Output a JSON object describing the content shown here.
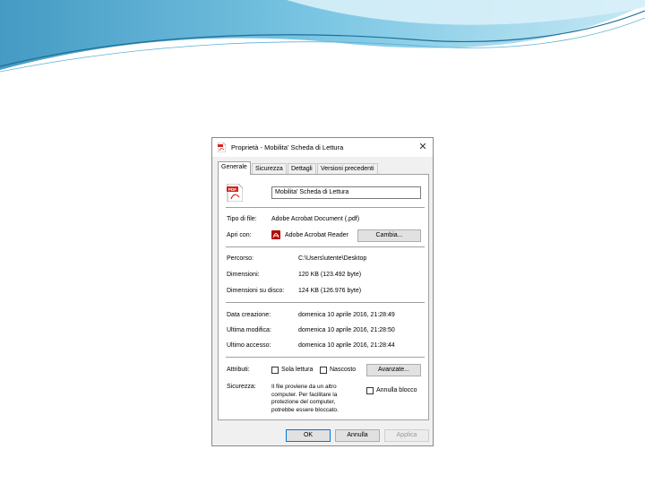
{
  "dialog": {
    "title": "Proprietà - Mobilita' Scheda di Lettura",
    "close_glyph": "✕",
    "tabs": [
      "Generale",
      "Sicurezza",
      "Dettagli",
      "Versioni precedenti"
    ],
    "active_tab": "Generale",
    "file_name": "Mobilita' Scheda di Lettura",
    "type_label": "Tipo di file:",
    "type_value": "Adobe Acrobat Document (.pdf)",
    "open_with_label": "Apri con:",
    "open_with_value": "Adobe Acrobat Reader",
    "change_button": "Cambia...",
    "path_label": "Percorso:",
    "path_value": "C:\\Users\\utente\\Desktop",
    "size_label": "Dimensioni:",
    "size_value": "120 KB (123.492 byte)",
    "disk_size_label": "Dimensioni su disco:",
    "disk_size_value": "124 KB (126.976 byte)",
    "created_label": "Data creazione:",
    "created_value": "domenica 10 aprile 2016, 21:28:49",
    "modified_label": "Ultima modifica:",
    "modified_value": "domenica 10 aprile 2016, 21:28:50",
    "accessed_label": "Ultimo accesso:",
    "accessed_value": "domenica 10 aprile 2016, 21:28:44",
    "attributes_label": "Attributi:",
    "readonly_label": "Sola lettura",
    "hidden_label": "Nascosto",
    "advanced_button": "Avanzate...",
    "security_label": "Sicurezza:",
    "security_text": "Il file proviene da un altro computer. Per facilitare la protezione del computer, potrebbe essere bloccato.",
    "unblock_label": "Annulla blocco",
    "ok_button": "OK",
    "cancel_button": "Annulla",
    "apply_button": "Applica",
    "icons": {
      "title": "pdf-file-icon",
      "file": "pdf-file-icon",
      "app": "acrobat-reader-icon"
    }
  },
  "colors": {
    "accent": "#0078d7",
    "header_wave_dark": "#3a9cc4",
    "header_wave_light": "#9fd6ea",
    "pdf_red": "#d4251c"
  }
}
